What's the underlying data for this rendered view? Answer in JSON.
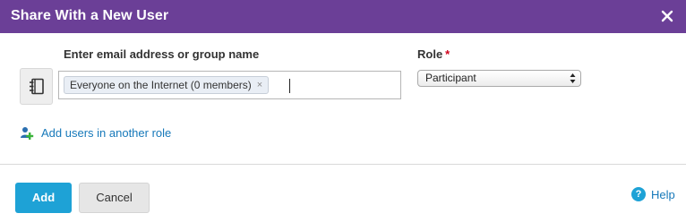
{
  "dialog": {
    "title": "Share With a New User",
    "close_icon": "close-icon"
  },
  "recipient": {
    "label": "Enter email address or group name",
    "tokens": [
      {
        "text": "Everyone on the Internet (0 members)",
        "remove_icon": "remove-token-icon",
        "remove_glyph": "×"
      }
    ],
    "value": ""
  },
  "role": {
    "label": "Role",
    "required_marker": "*",
    "selected": "Participant"
  },
  "add_role": {
    "icon": "add-user-icon",
    "label": "Add users in another role"
  },
  "footer": {
    "add_label": "Add",
    "cancel_label": "Cancel",
    "help_label": "Help",
    "help_icon_glyph": "?"
  },
  "colors": {
    "header_bg": "#6b3f97",
    "primary_button": "#1ea2d6",
    "link": "#1779ba",
    "required": "#d0021b"
  }
}
